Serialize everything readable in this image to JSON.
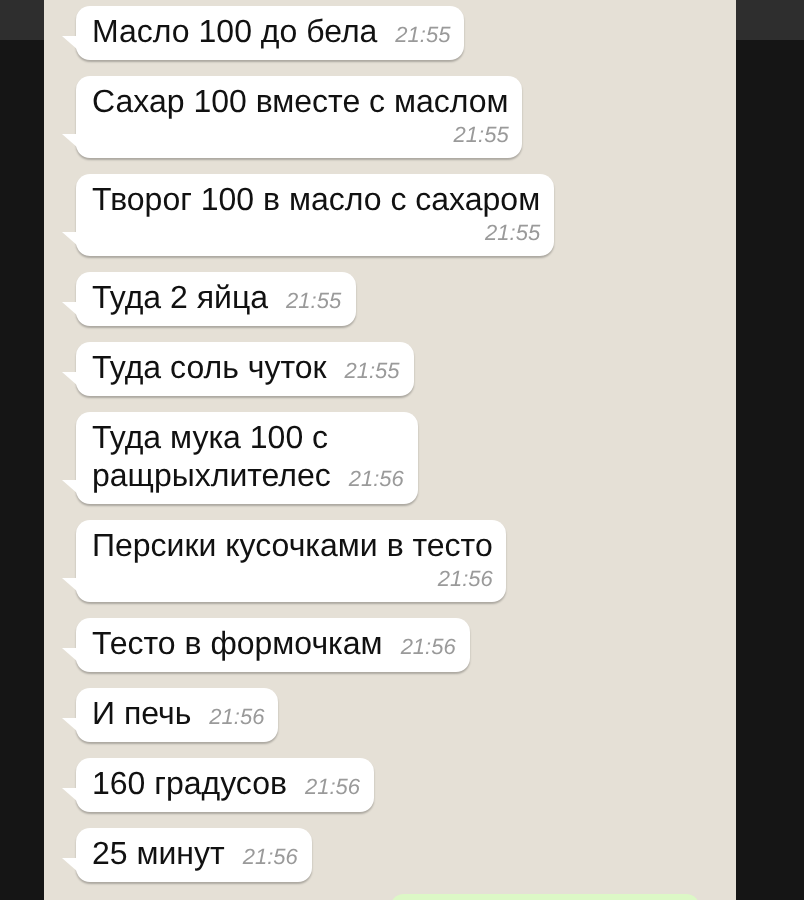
{
  "messages": [
    {
      "text": "Масло 100 до бела",
      "time": "21:55",
      "kind": "inline"
    },
    {
      "text": "Сахар 100 вместе с маслом",
      "time": "21:55",
      "kind": "stacked"
    },
    {
      "text": "Творог 100 в масло с сахаром",
      "time": "21:55",
      "kind": "stacked"
    },
    {
      "text": "Туда 2 яйца",
      "time": "21:55",
      "kind": "inline"
    },
    {
      "text": "Туда соль чуток",
      "time": "21:55",
      "kind": "inline"
    },
    {
      "text": "Туда мука 100 с\nращрыхлителес",
      "time": "21:56",
      "kind": "inline"
    },
    {
      "text": "Персики кусочками в тесто",
      "time": "21:56",
      "kind": "stacked"
    },
    {
      "text": "Тесто в формочкам",
      "time": "21:56",
      "kind": "inline"
    },
    {
      "text": "И печь",
      "time": "21:56",
      "kind": "inline"
    },
    {
      "text": "160 градусов",
      "time": "21:56",
      "kind": "inline"
    },
    {
      "text": "25 минут",
      "time": "21:56",
      "kind": "inline"
    }
  ]
}
